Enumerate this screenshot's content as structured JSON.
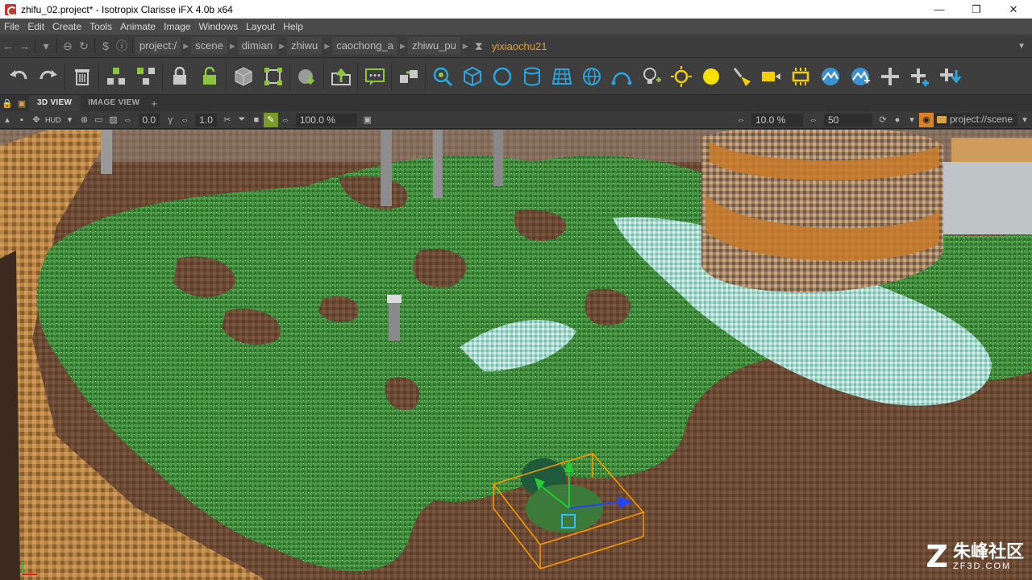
{
  "window": {
    "title": "zhifu_02.project* - Isotropix Clarisse iFX 4.0b x64",
    "minimize": "—",
    "maximize": "❐",
    "close": "✕"
  },
  "menu": [
    "File",
    "Edit",
    "Create",
    "Tools",
    "Animate",
    "Image",
    "Windows",
    "Layout",
    "Help"
  ],
  "path": {
    "crumbs": [
      "project:/",
      "scene",
      "dimian",
      "zhiwu",
      "caochong_a",
      "zhiwu_pu"
    ],
    "current": "yixiaochu21"
  },
  "tabs": {
    "view3d": "3D VIEW",
    "image_view": "IMAGE VIEW",
    "add": "+"
  },
  "viewbar": {
    "hud_label": "HUD",
    "field_a": "0.0",
    "field_b": "1.0",
    "zoom": "100.0 %",
    "percent": "10.0 %",
    "count": "50",
    "context": "project://scene"
  },
  "watermark": {
    "logo": "Z",
    "cn": "朱峰社区",
    "en": "ZF3D.COM"
  },
  "colors": {
    "accent": "#e0a030",
    "grass": "#3f8a3a",
    "dirt": "#6b4a33",
    "selection": "#ff9900"
  }
}
